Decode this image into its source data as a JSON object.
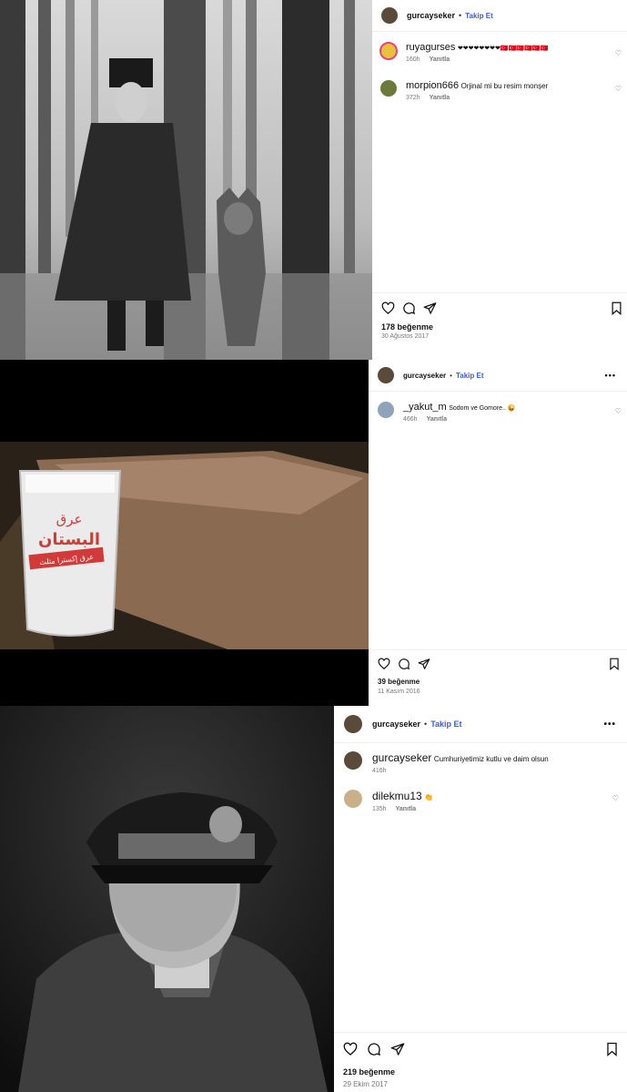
{
  "posts": [
    {
      "username": "gurcayseker",
      "follow_label": "Takip Et",
      "comments": [
        {
          "user": "ruyagurses",
          "text": "❤❤❤❤❤❤❤❤🇹🇷🇹🇷🇹🇷🇹🇷🇹🇷🇹🇷",
          "time": "160h",
          "reply": "Yanıtla"
        },
        {
          "user": "morpion666",
          "text": "Orjinal mi bu resim monşer",
          "time": "372h",
          "reply": "Yanıtla"
        }
      ],
      "likes": "178 beğenme",
      "date": "30 Ağustos 2017"
    },
    {
      "username": "gurcayseker",
      "follow_label": "Takip Et",
      "comments": [
        {
          "user": "_yakut_m",
          "text": "Sodom ve Gomore.. 😜",
          "time": "466h",
          "reply": "Yanıtla"
        }
      ],
      "glass_text_1": "عرق",
      "glass_text_2": "البستان",
      "glass_text_3": "عرق إكسترا مثلث",
      "likes": "39 beğenme",
      "date": "11 Kasım 2016"
    },
    {
      "username": "gurcayseker",
      "follow_label": "Takip Et",
      "caption": {
        "user": "gurcayseker",
        "text": "Cumhuriyetimiz kutlu ve daim olsun",
        "time": "416h"
      },
      "comments": [
        {
          "user": "dilekmu13",
          "text": "👏",
          "time": "135h",
          "reply": "Yanıtla"
        }
      ],
      "likes": "219 beğenme",
      "date": "29 Ekim 2017"
    }
  ],
  "colors": {
    "follow": "#3b5bdb",
    "meta": "#777777",
    "border": "#efefef"
  }
}
